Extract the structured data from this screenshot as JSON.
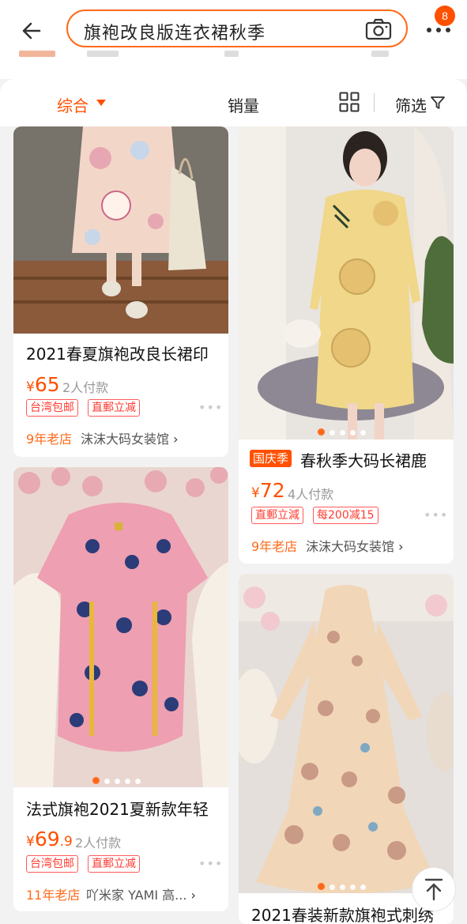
{
  "search": {
    "query": "旗袍改良版连衣裙秋季"
  },
  "header": {
    "badge_count": "8"
  },
  "sort": {
    "comprehensive": "综合",
    "sales": "销量",
    "filter": "筛选"
  },
  "products": [
    {
      "title": "2021春夏旗袍改良长裙印",
      "price_symbol": "¥",
      "price_int": "65",
      "price_dec": "",
      "sales": "2人付款",
      "tags": [
        "台湾包邮",
        "直郵立减"
      ],
      "shop_age": "9年老店",
      "shop_name": "沫沫大码女装馆"
    },
    {
      "promo": "国庆季",
      "title": "春秋季大码长裙鹿",
      "price_symbol": "¥",
      "price_int": "72",
      "price_dec": "",
      "sales": "4人付款",
      "tags": [
        "直郵立減",
        "每200减15"
      ],
      "shop_age": "9年老店",
      "shop_name": "沫沫大码女装馆"
    },
    {
      "title": "法式旗袍2021夏新款年轻",
      "price_symbol": "¥",
      "price_int": "69",
      "price_dec": ".9",
      "sales": "2人付款",
      "tags": [
        "台湾包邮",
        "直郵立减"
      ],
      "shop_age": "11年老店",
      "shop_name": "吖米家 YAMI 高..."
    },
    {
      "title": "2021春装新款旗袍式刺绣"
    }
  ],
  "icons": {
    "back": "back-arrow-icon",
    "camera": "camera-icon",
    "more": "more-dots-icon",
    "grid": "grid-view-icon",
    "filter": "filter-funnel-icon",
    "top": "back-to-top-icon"
  },
  "colors": {
    "accent": "#ff5000",
    "tag_red": "#ff3b30",
    "shop_orange": "#ff6a1a"
  }
}
